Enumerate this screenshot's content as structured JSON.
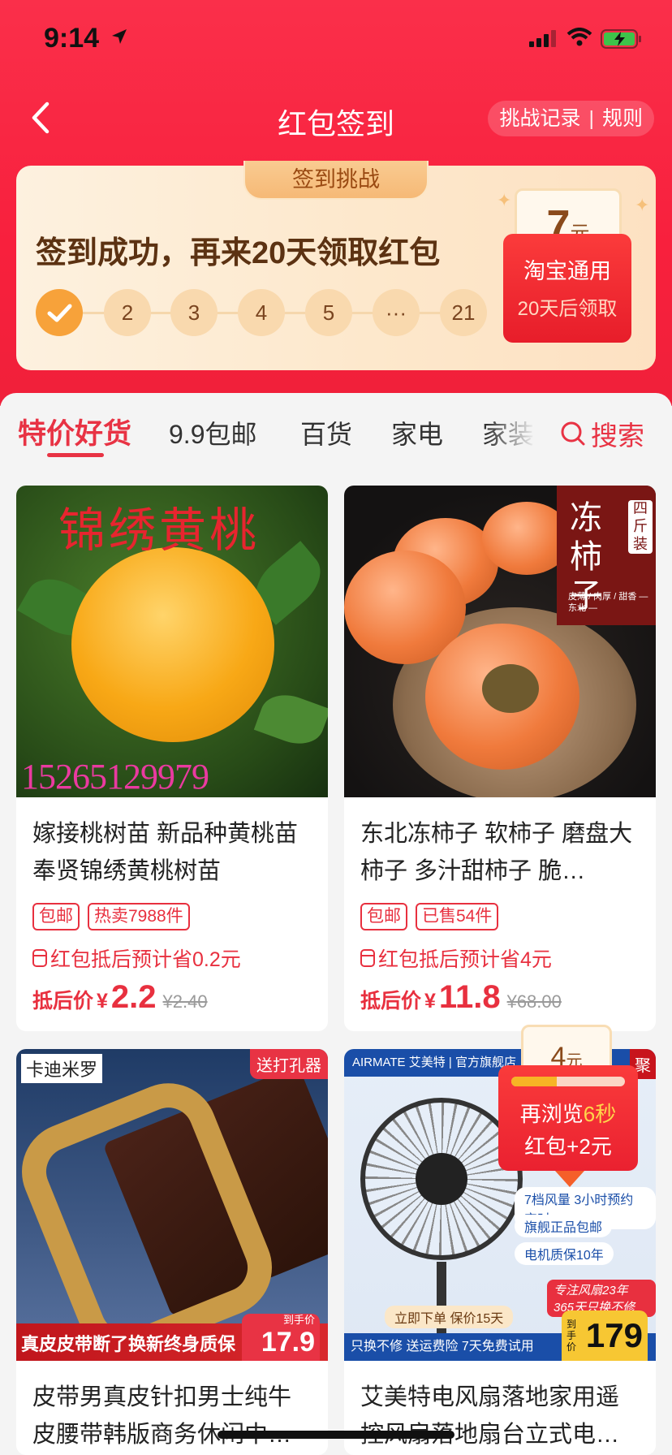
{
  "status": {
    "time": "9:14"
  },
  "nav": {
    "title": "红包签到",
    "records": "挑战记录",
    "separator": "|",
    "rules": "规则"
  },
  "checkin": {
    "tab_label": "签到挑战",
    "message": "签到成功，再来20天领取红包",
    "steps": [
      "2",
      "3",
      "4",
      "5",
      "···",
      "21"
    ],
    "reward": {
      "amount": "7",
      "unit": "元",
      "line1": "淘宝通用",
      "line2": "20天后领取"
    }
  },
  "tabs": {
    "items": [
      "特价好货",
      "9.9包邮",
      "百货",
      "家电",
      "家装"
    ],
    "search": "搜索"
  },
  "products": [
    {
      "image_text": "锦绣黄桃",
      "image_phone": "15265129979",
      "title": "嫁接桃树苗 新品种黄桃苗 奉贤锦绣黄桃树苗",
      "tags": [
        "包邮",
        "热卖7988件"
      ],
      "coupon": "红包抵后预计省0.2元",
      "price_label": "抵后价",
      "currency": "¥",
      "price": "2.2",
      "old_price": "¥2.40"
    },
    {
      "image_text": "冻柿子",
      "image_sub": "四斤装",
      "image_tiny": "皮薄 / 肉厚 / 甜香 — 东北 —",
      "title": "东北冻柿子 软柿子 磨盘大柿子 多汁甜柿子 脆…",
      "tags": [
        "包邮",
        "已售54件"
      ],
      "coupon": "红包抵后预计省4元",
      "price_label": "抵后价",
      "currency": "¥",
      "price": "11.8",
      "old_price": "¥68.00"
    },
    {
      "image_brand": "卡迪米罗",
      "image_gift": "送打孔器",
      "image_bottom": "真皮皮带断了换新终身质保",
      "image_price_label": "到手价",
      "image_price": "17.9",
      "title": "皮带男真皮针扣男士纯牛皮腰带韩版商务休闲中…"
    },
    {
      "image_top": "AIRMATE 艾美特 | 官方旗舰店",
      "image_cat": "聚",
      "image_features": [
        "7档风量 3小时预约定时",
        "旗舰正品包邮",
        "电机质保10年"
      ],
      "image_badge": "专注风扇23年 365天只换不修",
      "image_order": "立即下单 保价15天",
      "image_bottom": "只换不修 送运费险 7天免费试用",
      "image_price_label": "到手价",
      "image_price": "179",
      "title": "艾美特电风扇落地家用遥控风扇落地扇台立式电…"
    }
  ],
  "float_reward": {
    "amount": "4",
    "unit": "元",
    "line1_pre": "再浏览",
    "line1_hl": "6秒",
    "line2": "红包+2元",
    "progress": 0.4
  },
  "colors": {
    "brand_red": "#e83344",
    "header_red": "#fa2f4a",
    "gold": "#f7a23a"
  }
}
